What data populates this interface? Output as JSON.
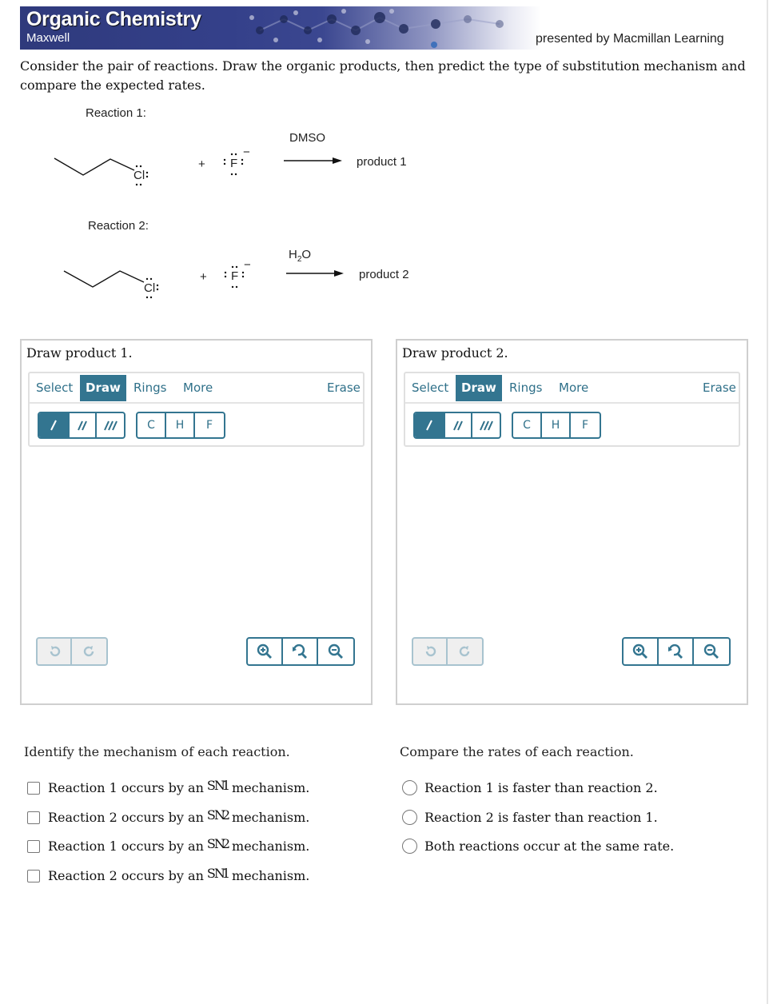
{
  "header": {
    "title": "Organic Chemistry",
    "subtitle": "Maxwell",
    "presented_by": "presented by Macmillan Learning"
  },
  "intro": "Consider the pair of reactions. Draw the organic products, then predict the type of substitution mechanism and compare the expected rates.",
  "reactions": [
    {
      "label": "Reaction 1:",
      "substrate_leaving_group": "Cl",
      "nucleophile": "F",
      "nucleophile_charge": "−",
      "plus": "+",
      "solvent": "DMSO",
      "product": "product 1"
    },
    {
      "label": "Reaction 2:",
      "substrate_leaving_group": "Cl",
      "nucleophile": "F",
      "nucleophile_charge": "−",
      "plus": "+",
      "solvent_main": "H",
      "solvent_sub": "2",
      "solvent_end": "O",
      "product": "product 2"
    }
  ],
  "draw_panels": [
    {
      "title": "Draw product 1.",
      "tabs": [
        "Select",
        "Draw",
        "Rings",
        "More"
      ],
      "active_tab": "Draw",
      "erase_label": "Erase",
      "bond_tools": [
        "single-bond",
        "double-bond",
        "triple-bond"
      ],
      "active_bond": "single-bond",
      "atoms": [
        "C",
        "H",
        "F"
      ],
      "undo_icons": [
        "undo-icon",
        "redo-icon"
      ],
      "zoom_icons": [
        "zoom-in-icon",
        "zoom-reset-icon",
        "zoom-out-icon"
      ]
    },
    {
      "title": "Draw product 2.",
      "tabs": [
        "Select",
        "Draw",
        "Rings",
        "More"
      ],
      "active_tab": "Draw",
      "erase_label": "Erase",
      "bond_tools": [
        "single-bond",
        "double-bond",
        "triple-bond"
      ],
      "active_bond": "single-bond",
      "atoms": [
        "C",
        "H",
        "F"
      ],
      "undo_icons": [
        "undo-icon",
        "redo-icon"
      ],
      "zoom_icons": [
        "zoom-in-icon",
        "zoom-reset-icon",
        "zoom-out-icon"
      ]
    }
  ],
  "mechanism": {
    "prompt": "Identify the mechanism of each reaction.",
    "options": [
      {
        "pre": "Reaction 1 occurs by an",
        "s": "S",
        "n": "N",
        "num": "1",
        "post": "mechanism.",
        "checked": false
      },
      {
        "pre": "Reaction 2 occurs by an",
        "s": "S",
        "n": "N",
        "num": "2",
        "post": "mechanism.",
        "checked": false
      },
      {
        "pre": "Reaction 1 occurs by an",
        "s": "S",
        "n": "N",
        "num": "2",
        "post": "mechanism.",
        "checked": false
      },
      {
        "pre": "Reaction 2 occurs by an",
        "s": "S",
        "n": "N",
        "num": "1",
        "post": "mechanism.",
        "checked": false
      }
    ]
  },
  "rates": {
    "prompt": "Compare the rates of each reaction.",
    "options": [
      {
        "label": "Reaction 1 is faster than reaction 2.",
        "selected": false
      },
      {
        "label": "Reaction 2 is faster than reaction 1.",
        "selected": false
      },
      {
        "label": "Both reactions occur at the same rate.",
        "selected": false
      }
    ]
  },
  "colors": {
    "accent": "#337590",
    "banner": "#2f3a7c"
  }
}
